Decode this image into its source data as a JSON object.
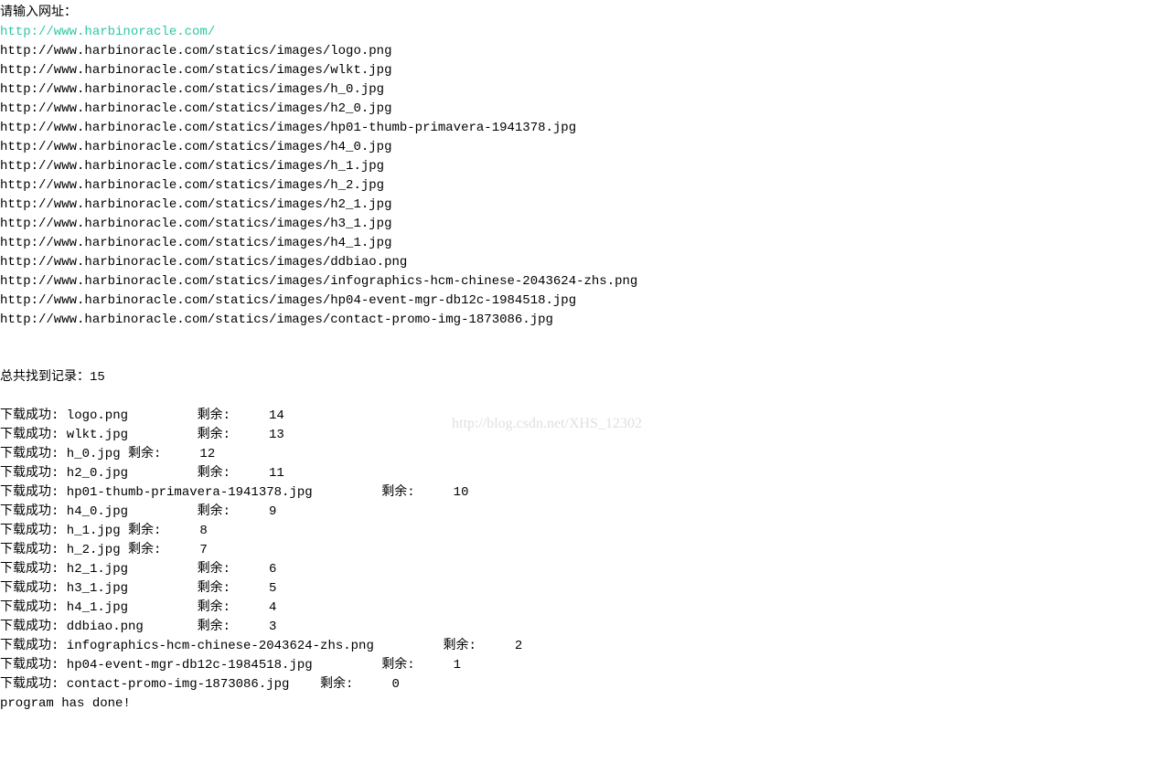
{
  "prompt": "请输入网址：",
  "input_url": "http://www.harbinoracle.com/",
  "urls": [
    "http://www.harbinoracle.com/statics/images/logo.png",
    "http://www.harbinoracle.com/statics/images/wlkt.jpg",
    "http://www.harbinoracle.com/statics/images/h_0.jpg",
    "http://www.harbinoracle.com/statics/images/h2_0.jpg",
    "http://www.harbinoracle.com/statics/images/hp01-thumb-primavera-1941378.jpg",
    "http://www.harbinoracle.com/statics/images/h4_0.jpg",
    "http://www.harbinoracle.com/statics/images/h_1.jpg",
    "http://www.harbinoracle.com/statics/images/h_2.jpg",
    "http://www.harbinoracle.com/statics/images/h2_1.jpg",
    "http://www.harbinoracle.com/statics/images/h3_1.jpg",
    "http://www.harbinoracle.com/statics/images/h4_1.jpg",
    "http://www.harbinoracle.com/statics/images/ddbiao.png",
    "http://www.harbinoracle.com/statics/images/infographics-hcm-chinese-2043624-zhs.png",
    "http://www.harbinoracle.com/statics/images/hp04-event-mgr-db12c-1984518.jpg",
    "http://www.harbinoracle.com/statics/images/contact-promo-img-1873086.jpg"
  ],
  "total_label": "总共找到记录：",
  "total_count": "15",
  "downloads": [
    {
      "text": "下载成功: logo.png         剩余:     14"
    },
    {
      "text": "下载成功: wlkt.jpg         剩余:     13"
    },
    {
      "text": "下载成功: h_0.jpg 剩余:     12"
    },
    {
      "text": "下载成功: h2_0.jpg         剩余:     11"
    },
    {
      "text": "下载成功: hp01-thumb-primavera-1941378.jpg         剩余:     10"
    },
    {
      "text": "下载成功: h4_0.jpg         剩余:     9"
    },
    {
      "text": "下载成功: h_1.jpg 剩余:     8"
    },
    {
      "text": "下载成功: h_2.jpg 剩余:     7"
    },
    {
      "text": "下载成功: h2_1.jpg         剩余:     6"
    },
    {
      "text": "下载成功: h3_1.jpg         剩余:     5"
    },
    {
      "text": "下载成功: h4_1.jpg         剩余:     4"
    },
    {
      "text": "下载成功: ddbiao.png       剩余:     3"
    },
    {
      "text": "下载成功: infographics-hcm-chinese-2043624-zhs.png         剩余:     2"
    },
    {
      "text": "下载成功: hp04-event-mgr-db12c-1984518.jpg         剩余:     1"
    },
    {
      "text": "下载成功: contact-promo-img-1873086.jpg    剩余:     0"
    }
  ],
  "done_message": "program has done!",
  "watermark": "http://blog.csdn.net/XHS_12302"
}
